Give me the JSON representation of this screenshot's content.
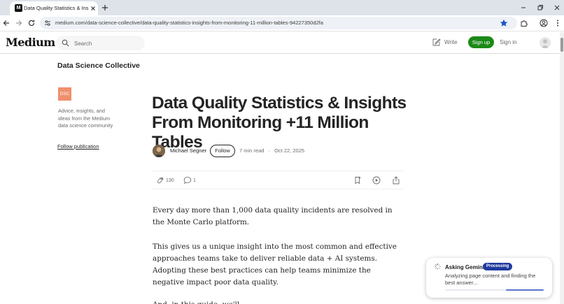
{
  "browser": {
    "tab_title": "Data Quality Statistics & Insights",
    "favicon_letter": "M",
    "url": "medium.com/data-science-collective/data-quality-statistics-insights-from-monitoring-11-million-tables-94227350d2fa"
  },
  "header": {
    "logo": "Medium",
    "search_placeholder": "Search",
    "write_label": "Write",
    "signup_label": "Sign up",
    "signin_label": "Sign in"
  },
  "publication": {
    "name": "Data Science Collective",
    "logo_text": "DSC",
    "logo_color": "#f08f6c",
    "description": "Advice, insights, and ideas from the Medium data science community",
    "follow_label": "Follow publication"
  },
  "article": {
    "title": "Data Quality Statistics & Insights From Monitoring +11 Million Tables",
    "author": "Michael Segner",
    "follow_label": "Follow",
    "read_time": "7 min read",
    "separator": "·",
    "date": "Oct 22, 2025",
    "claps": "130",
    "responses": "1",
    "paragraphs": [
      "Every day more than 1,000 data quality incidents are resolved in the Monte Carlo platform.",
      "This gives us a unique insight into the most common and effective approaches teams take to deliver reliable data + AI systems. Adopting these best practices can help teams minimize the negative impact poor data quality.",
      "And, in this guide, we'll..."
    ]
  },
  "gemini": {
    "title": "Asking Gemini",
    "badge": "Processing",
    "status": "Analyzing page content and finding the best answer...",
    "progress": 0.38,
    "accent": "#1f3a9e"
  },
  "colors": {
    "medium_green": "#1a8917",
    "text": "#242424",
    "muted": "#6b6b6b",
    "star_blue": "#1a56c4"
  }
}
